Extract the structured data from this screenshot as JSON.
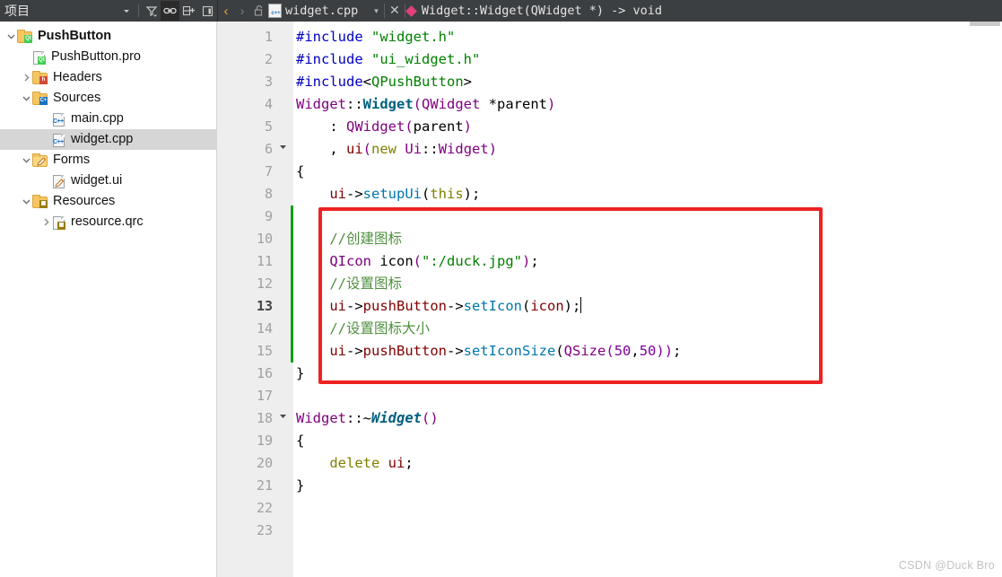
{
  "window": {
    "sidebar_title": "项目",
    "toolbar_icons": [
      {
        "name": "chevron-down-icon",
        "glyph": "▾",
        "active": false
      },
      {
        "name": "filter-icon",
        "glyph": "",
        "active": false
      },
      {
        "name": "link-icon",
        "glyph": "",
        "active": true
      },
      {
        "name": "split-add-icon",
        "glyph": "",
        "active": false
      },
      {
        "name": "close-sidebar-icon",
        "glyph": "",
        "active": false
      }
    ]
  },
  "tabbar": {
    "back_glyph": "‹",
    "forward_glyph": "›",
    "lock_icon": "unlocked-padlock-icon",
    "file_icon": "cpp-file-icon",
    "filename": "widget.cpp",
    "caret_glyph": "▾",
    "close_glyph": "✕",
    "symbol_icon": "function-diamond-icon",
    "symbol": "Widget::Widget(QWidget *) -> void"
  },
  "sidebar": {
    "items": [
      {
        "label": "PushButton",
        "indent": 0,
        "arrow": "v",
        "icon": "folder-qt",
        "bold": true,
        "selected": false
      },
      {
        "label": "PushButton.pro",
        "indent": 1,
        "arrow": "",
        "icon": "file-qt",
        "bold": false,
        "selected": false
      },
      {
        "label": "Headers",
        "indent": 1,
        "arrow": ">",
        "icon": "folder-h",
        "bold": false,
        "selected": false
      },
      {
        "label": "Sources",
        "indent": 1,
        "arrow": "v",
        "icon": "folder-cpp",
        "bold": false,
        "selected": false
      },
      {
        "label": "main.cpp",
        "indent": 2,
        "arrow": "",
        "icon": "file-cpp",
        "bold": false,
        "selected": false
      },
      {
        "label": "widget.cpp",
        "indent": 2,
        "arrow": "",
        "icon": "file-cpp",
        "bold": false,
        "selected": true
      },
      {
        "label": "Forms",
        "indent": 1,
        "arrow": "v",
        "icon": "folder-form",
        "bold": false,
        "selected": false
      },
      {
        "label": "widget.ui",
        "indent": 2,
        "arrow": "",
        "icon": "file-ui",
        "bold": false,
        "selected": false
      },
      {
        "label": "Resources",
        "indent": 1,
        "arrow": "v",
        "icon": "folder-res",
        "bold": false,
        "selected": false
      },
      {
        "label": "resource.qrc",
        "indent": 2,
        "arrow": ">",
        "icon": "file-qrc",
        "bold": false,
        "selected": false
      }
    ]
  },
  "editor": {
    "language": "cpp",
    "cursor_line": 13,
    "changed_lines": [
      9,
      10,
      11,
      12,
      13,
      14,
      15
    ],
    "fold_lines": [
      6,
      18
    ],
    "lines": [
      {
        "n": 1,
        "tokens": [
          {
            "t": "#include ",
            "c": "s-pre"
          },
          {
            "t": "\"widget.h\"",
            "c": "s-str"
          }
        ]
      },
      {
        "n": 2,
        "tokens": [
          {
            "t": "#include ",
            "c": "s-pre"
          },
          {
            "t": "\"ui_widget.h\"",
            "c": "s-str"
          }
        ]
      },
      {
        "n": 3,
        "tokens": [
          {
            "t": "#include",
            "c": "s-pre"
          },
          {
            "t": "<",
            "c": "s-op"
          },
          {
            "t": "QPushButton",
            "c": "s-str"
          },
          {
            "t": ">",
            "c": "s-op"
          }
        ]
      },
      {
        "n": 4,
        "tokens": [
          {
            "t": "Widget",
            "c": "s-cls"
          },
          {
            "t": "::",
            "c": "s-op"
          },
          {
            "t": "Widget",
            "c": "s-fn"
          },
          {
            "t": "(",
            "c": "s-cls"
          },
          {
            "t": "QWidget",
            "c": "s-cls"
          },
          {
            "t": " *parent",
            "c": "s-op"
          },
          {
            "t": ")",
            "c": "s-cls"
          }
        ]
      },
      {
        "n": 5,
        "tokens": [
          {
            "t": "    : ",
            "c": "s-op"
          },
          {
            "t": "QWidget",
            "c": "s-cls"
          },
          {
            "t": "(",
            "c": "s-cls"
          },
          {
            "t": "parent",
            "c": "s-op"
          },
          {
            "t": ")",
            "c": "s-cls"
          }
        ]
      },
      {
        "n": 6,
        "tokens": [
          {
            "t": "    , ",
            "c": "s-op"
          },
          {
            "t": "ui",
            "c": "s-field"
          },
          {
            "t": "(",
            "c": "s-cls"
          },
          {
            "t": "new",
            "c": "s-kw"
          },
          {
            "t": " ",
            "c": "s-op"
          },
          {
            "t": "Ui",
            "c": "s-cls"
          },
          {
            "t": "::",
            "c": "s-op"
          },
          {
            "t": "Widget",
            "c": "s-cls"
          },
          {
            "t": ")",
            "c": "s-cls"
          }
        ]
      },
      {
        "n": 7,
        "tokens": [
          {
            "t": "{",
            "c": "s-op"
          }
        ]
      },
      {
        "n": 8,
        "tokens": [
          {
            "t": "    ",
            "c": "s-op"
          },
          {
            "t": "ui",
            "c": "s-field"
          },
          {
            "t": "->",
            "c": "s-op"
          },
          {
            "t": "setupUi",
            "c": "s-call"
          },
          {
            "t": "(",
            "c": "s-op"
          },
          {
            "t": "this",
            "c": "s-kw"
          },
          {
            "t": ");",
            "c": "s-op"
          }
        ]
      },
      {
        "n": 9,
        "tokens": []
      },
      {
        "n": 10,
        "tokens": [
          {
            "t": "    //创建图标",
            "c": "s-cmt"
          }
        ]
      },
      {
        "n": 11,
        "tokens": [
          {
            "t": "    ",
            "c": "s-op"
          },
          {
            "t": "QIcon",
            "c": "s-cls"
          },
          {
            "t": " icon",
            "c": "s-op"
          },
          {
            "t": "(",
            "c": "s-cls"
          },
          {
            "t": "\":/duck.jpg\"",
            "c": "s-str"
          },
          {
            "t": ")",
            "c": "s-cls"
          },
          {
            "t": ";",
            "c": "s-op"
          }
        ]
      },
      {
        "n": 12,
        "tokens": [
          {
            "t": "    //设置图标",
            "c": "s-cmt"
          }
        ]
      },
      {
        "n": 13,
        "tokens": [
          {
            "t": "    ",
            "c": "s-op"
          },
          {
            "t": "ui",
            "c": "s-field"
          },
          {
            "t": "->",
            "c": "s-op"
          },
          {
            "t": "pushButton",
            "c": "s-field"
          },
          {
            "t": "->",
            "c": "s-op"
          },
          {
            "t": "setIcon",
            "c": "s-call"
          },
          {
            "t": "(",
            "c": "s-op"
          },
          {
            "t": "icon",
            "c": "s-field"
          },
          {
            "t": ");",
            "c": "s-op"
          }
        ],
        "cursor": true
      },
      {
        "n": 14,
        "tokens": [
          {
            "t": "    //设置图标大小",
            "c": "s-cmt"
          }
        ]
      },
      {
        "n": 15,
        "tokens": [
          {
            "t": "    ",
            "c": "s-op"
          },
          {
            "t": "ui",
            "c": "s-field"
          },
          {
            "t": "->",
            "c": "s-op"
          },
          {
            "t": "pushButton",
            "c": "s-field"
          },
          {
            "t": "->",
            "c": "s-op"
          },
          {
            "t": "setIconSize",
            "c": "s-call"
          },
          {
            "t": "(",
            "c": "s-op"
          },
          {
            "t": "QSize",
            "c": "s-cls"
          },
          {
            "t": "(",
            "c": "s-num"
          },
          {
            "t": "50",
            "c": "s-num"
          },
          {
            "t": ",",
            "c": "s-op"
          },
          {
            "t": "50",
            "c": "s-num"
          },
          {
            "t": "))",
            "c": "s-num"
          },
          {
            "t": ";",
            "c": "s-op"
          }
        ]
      },
      {
        "n": 16,
        "tokens": [
          {
            "t": "}",
            "c": "s-op"
          }
        ]
      },
      {
        "n": 17,
        "tokens": []
      },
      {
        "n": 18,
        "tokens": [
          {
            "t": "Widget",
            "c": "s-cls"
          },
          {
            "t": "::~",
            "c": "s-op"
          },
          {
            "t": "Widget",
            "c": "s-dtor"
          },
          {
            "t": "()",
            "c": "s-cls"
          }
        ]
      },
      {
        "n": 19,
        "tokens": [
          {
            "t": "{",
            "c": "s-op"
          }
        ]
      },
      {
        "n": 20,
        "tokens": [
          {
            "t": "    ",
            "c": "s-op"
          },
          {
            "t": "delete",
            "c": "s-kw"
          },
          {
            "t": " ",
            "c": "s-op"
          },
          {
            "t": "ui",
            "c": "s-field"
          },
          {
            "t": ";",
            "c": "s-op"
          }
        ]
      },
      {
        "n": 21,
        "tokens": [
          {
            "t": "}",
            "c": "s-op"
          }
        ]
      },
      {
        "n": 22,
        "tokens": []
      },
      {
        "n": 23,
        "tokens": []
      }
    ]
  },
  "annotation": {
    "shape": "rectangle",
    "color": "#ee2222",
    "covers_lines": "9-16"
  },
  "watermark": "CSDN @Duck Bro"
}
